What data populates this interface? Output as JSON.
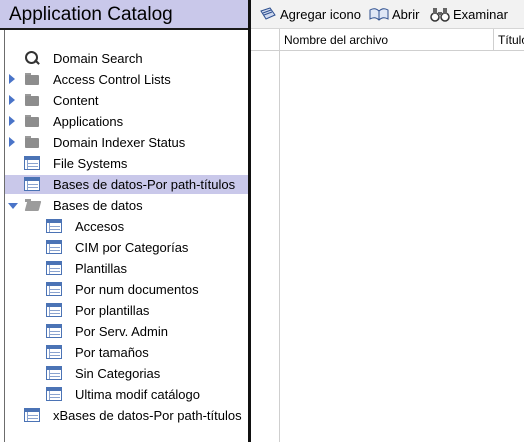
{
  "left_pane": {
    "title": "Application Catalog"
  },
  "tree": {
    "items": [
      {
        "label": "Domain Search",
        "icon": "search-icon",
        "expander": "none",
        "indent": 0,
        "selected": false
      },
      {
        "label": "Access Control Lists",
        "icon": "folder-icon",
        "expander": "collapsed",
        "indent": 0,
        "selected": false
      },
      {
        "label": "Content",
        "icon": "folder-icon",
        "expander": "collapsed",
        "indent": 0,
        "selected": false
      },
      {
        "label": "Applications",
        "icon": "folder-icon",
        "expander": "collapsed",
        "indent": 0,
        "selected": false
      },
      {
        "label": "Domain Indexer Status",
        "icon": "folder-icon",
        "expander": "collapsed",
        "indent": 0,
        "selected": false
      },
      {
        "label": "File Systems",
        "icon": "table-icon",
        "expander": "none",
        "indent": 0,
        "selected": false
      },
      {
        "label": "Bases de datos-Por path-títulos",
        "icon": "table-icon",
        "expander": "none",
        "indent": 0,
        "selected": true
      },
      {
        "label": "Bases de datos",
        "icon": "folder-open-icon",
        "expander": "expanded",
        "indent": 0,
        "selected": false
      },
      {
        "label": "Accesos",
        "icon": "table-icon",
        "expander": "none",
        "indent": 1,
        "selected": false
      },
      {
        "label": "CIM por Categorías",
        "icon": "table-icon",
        "expander": "none",
        "indent": 1,
        "selected": false
      },
      {
        "label": "Plantillas",
        "icon": "table-icon",
        "expander": "none",
        "indent": 1,
        "selected": false
      },
      {
        "label": "Por num documentos",
        "icon": "table-icon",
        "expander": "none",
        "indent": 1,
        "selected": false
      },
      {
        "label": "Por plantillas",
        "icon": "table-icon",
        "expander": "none",
        "indent": 1,
        "selected": false
      },
      {
        "label": "Por Serv. Admin",
        "icon": "table-icon",
        "expander": "none",
        "indent": 1,
        "selected": false
      },
      {
        "label": "Por tamaños",
        "icon": "table-icon",
        "expander": "none",
        "indent": 1,
        "selected": false
      },
      {
        "label": "Sin Categorias",
        "icon": "table-icon",
        "expander": "none",
        "indent": 1,
        "selected": false
      },
      {
        "label": "Ultima modif catálogo",
        "icon": "table-icon",
        "expander": "none",
        "indent": 1,
        "selected": false
      },
      {
        "label": "xBases de datos-Por path-títulos",
        "icon": "table-icon",
        "expander": "none",
        "indent": 0,
        "selected": false
      }
    ]
  },
  "toolbar": {
    "add_icon_label": "Agregar icono",
    "open_label": "Abrir",
    "examine_label": "Examinar"
  },
  "grid": {
    "columns": [
      "Nombre del archivo",
      "Título"
    ]
  },
  "colors": {
    "header_bg": "#c9c8ea",
    "selection_bg": "#c9c8ea",
    "expander_arrow": "#4a74c8",
    "table_icon": "#4b73b5"
  }
}
